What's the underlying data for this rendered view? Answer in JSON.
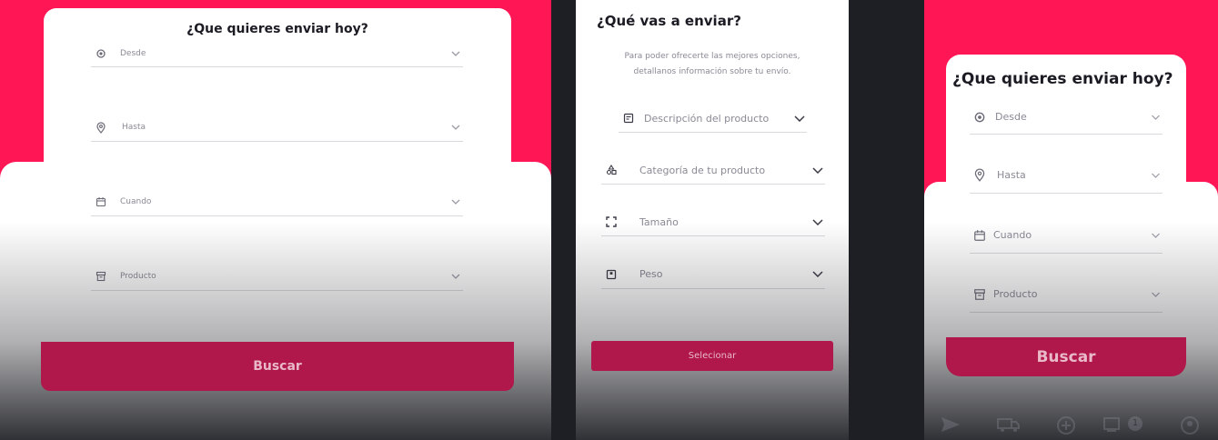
{
  "panel1": {
    "title": "¿Que quieres enviar hoy?",
    "fields": [
      {
        "label": "Desde",
        "icon": "location-target-icon"
      },
      {
        "label": "Hasta",
        "icon": "map-pin-icon"
      },
      {
        "label": "Cuando",
        "icon": "calendar-icon"
      },
      {
        "label": "Producto",
        "icon": "box-icon"
      }
    ],
    "button": "Buscar"
  },
  "panel2": {
    "title": "¿Qué vas a enviar?",
    "subtitle_line1": "Para poder ofrecerte las mejores opciones,",
    "subtitle_line2": "detallanos información sobre tu envío.",
    "fields": [
      {
        "label": "Descripción del producto",
        "icon": "document-icon"
      },
      {
        "label": "Categoría de tu producto",
        "icon": "shapes-icon"
      },
      {
        "label": "Tamaño",
        "icon": "resize-corners-icon"
      },
      {
        "label": "Peso",
        "icon": "weight-icon"
      }
    ],
    "button": "Selecionar"
  },
  "panel3": {
    "title": "¿Que quieres enviar hoy?",
    "fields": [
      {
        "label": "Desde",
        "icon": "location-target-icon"
      },
      {
        "label": "Hasta",
        "icon": "map-pin-icon"
      },
      {
        "label": "Cuando",
        "icon": "calendar-icon"
      },
      {
        "label": "Producto",
        "icon": "box-icon"
      }
    ],
    "button": "Buscar",
    "nav_badge": "1",
    "nav_icons": [
      "send-icon",
      "truck-icon",
      "add-circle-icon",
      "shipments-icon",
      "profile-icon"
    ]
  },
  "colors": {
    "brand_pink": "#ff1654",
    "button_crimson": "#b0174a",
    "background_dark": "#1e1f24"
  }
}
